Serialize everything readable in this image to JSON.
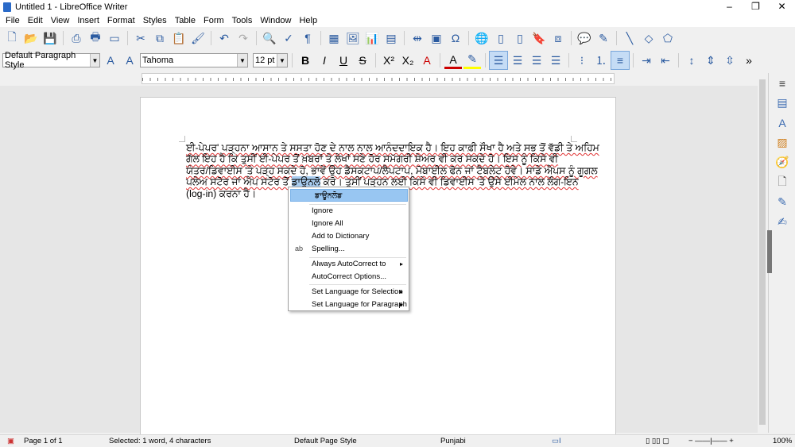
{
  "window": {
    "title": "Untitled 1 - LibreOffice Writer",
    "minimize": "–",
    "maximize": "❐",
    "close": "✕"
  },
  "menu": [
    "File",
    "Edit",
    "View",
    "Insert",
    "Format",
    "Styles",
    "Table",
    "Form",
    "Tools",
    "Window",
    "Help"
  ],
  "formatting": {
    "paragraph_style": "Default Paragraph Style",
    "font_name": "Tahoma",
    "font_size": "12 pt"
  },
  "document": {
    "lines": [
      "ਈ-ਪੇਪਰ' ਪੜ੍ਹਨਾ ਆਸਾਨ ਤੇ ਸਸਤਾ ਹੋਣ ਦੇ ਨਾਲ ਨਾਲ ਆਨੰਦਦਾਇਕ ਹੈ। ਇਹ ਕਾਫ਼ੀ ਸੌਖਾ ਹੈ ਅਤੇ ਸਭ ਤੋਂ ਵੱਡੀ ਤੇ ਅਹਿਮ",
      "ਗੱਲ ਇਹ ਹੈ ਕਿ ਤੁਸੀਂ ਈ-ਪੇਪਰ ਤੋਂ ਖ਼ਬਰਾਂ ਤੇ ਲੇਖਾਂ ਸਣੇ ਹੋਰ ਸਮੱਗਰੀ ਸ਼ੇਅਰ ਵੀ ਕਰ ਸਕਦੇ ਹੋ। ਇਸ ਨੂੰ ਕਿਸੇ ਵੀ",
      "ਯੰਤਰ/ਡਿਵਾਈਸ 'ਤੇ ਪੜ੍ਹ ਸਕਦੇ ਹੋ, ਭਾਵੇਂ ਉਹ ਡੈਸਕਟਾਪ/ਲੈਪਟਾਪ, ਮੋਬਾਈਲ ਫੋਨ ਜਾਂ ਟੈਬਲੇਟ ਹੋਵੇ। ਸਾਡੇ ਐਪਸ ਨੂੰ ਗੂਗਲ"
    ],
    "line4_before": "ਪਲੇਅ ਸਟੋਰ ਜਾਂ ਐਪ ਸਟੋਰ ਤੋਂ ",
    "selected_word": "ਡਾਊਨਲੋ",
    "line4_after": " ਕਰੋ। ਤੁਸੀਂ ਪੜ੍ਹਨ ਲਈ ਕਿਸੇ ਵੀ ਡਿਵਾਈਸ 'ਤੇ ਉਸੇ ਈਮੇਲ ਨਾਲ ਲੌਗ-ਇਨ",
    "line5": "(log-in) ਕਰਨਾ ਹੈ।"
  },
  "context_menu": {
    "suggestion": "ਡਾਊਨਲੋਡ",
    "ignore": "Ignore",
    "ignore_all": "Ignore All",
    "add_to_dictionary": "Add to Dictionary",
    "spelling": "Spelling...",
    "always_autocorrect": "Always AutoCorrect to",
    "autocorrect_options": "AutoCorrect Options...",
    "lang_selection": "Set Language for Selection",
    "lang_paragraph": "Set Language for Paragraph",
    "spelling_icon_text": "ab"
  },
  "status": {
    "page": "Page 1 of 1",
    "selection": "Selected: 1 word, 4 characters",
    "page_style": "Default Page Style",
    "language": "Punjabi",
    "zoom": "100%"
  },
  "colors": {
    "accent": "#2a5aa0",
    "selection": "#a9cdf0",
    "menu_highlight": "#98c6f2",
    "spellcheck": "#e03030"
  }
}
